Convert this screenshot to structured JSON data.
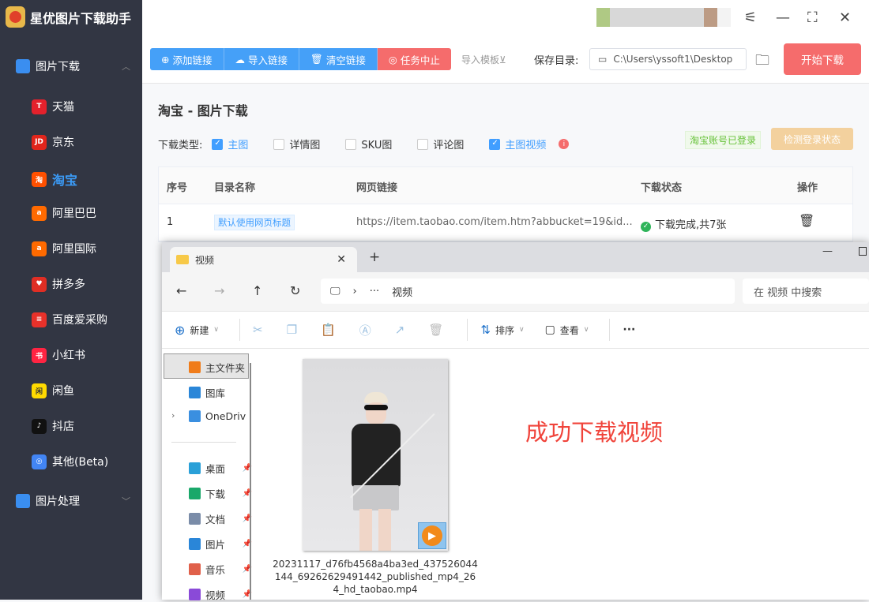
{
  "app": {
    "title": "星优图片下载助手"
  },
  "sidebar": {
    "groups": [
      {
        "label": "图片下载"
      },
      {
        "label": "图片处理"
      }
    ],
    "items": [
      {
        "label": "天猫",
        "icon": "T",
        "color": "#e4212c"
      },
      {
        "label": "京东",
        "icon": "JD",
        "color": "#e1251b"
      },
      {
        "label": "淘宝",
        "icon": "淘",
        "color": "#ff5000"
      },
      {
        "label": "阿里巴巴",
        "icon": "a",
        "color": "#ff6a00"
      },
      {
        "label": "阿里国际",
        "icon": "a",
        "color": "#ff6a00"
      },
      {
        "label": "拼多多",
        "icon": "♥",
        "color": "#e02e24"
      },
      {
        "label": "百度爱采购",
        "icon": "≡",
        "color": "#e8312a"
      },
      {
        "label": "小红书",
        "icon": "书",
        "color": "#ff2442"
      },
      {
        "label": "闲鱼",
        "icon": "闲",
        "color": "#ffda00"
      },
      {
        "label": "抖店",
        "icon": "♪",
        "color": "#111111"
      },
      {
        "label": "其他(Beta)",
        "icon": "◎",
        "color": "#4285f4"
      }
    ]
  },
  "toolbar": {
    "add": "添加链接",
    "import": "导入链接",
    "clear": "清空链接",
    "stop": "任务中止",
    "template": "导入模板⊻",
    "save_label": "保存目录:",
    "save_path": "C:\\Users\\yssoft1\\Desktop",
    "start": "开始下载"
  },
  "main": {
    "title": "淘宝 - 图片下载",
    "type_label": "下载类型:",
    "types": [
      {
        "label": "主图",
        "checked": true
      },
      {
        "label": "详情图",
        "checked": false
      },
      {
        "label": "SKU图",
        "checked": false
      },
      {
        "label": "评论图",
        "checked": false
      },
      {
        "label": "主图视频",
        "checked": true
      }
    ],
    "logged": "淘宝账号已登录",
    "check_login": "检测登录状态",
    "columns": [
      "序号",
      "目录名称",
      "网页链接",
      "下载状态",
      "操作"
    ],
    "rows": [
      {
        "no": "1",
        "dir": "默认使用网页标题",
        "url": "https://item.taobao.com/item.htm?abbucket=19&id...",
        "status": "下载完成,共7张"
      }
    ]
  },
  "explorer": {
    "tab": "视频",
    "address": "视频",
    "search_placeholder": "在 视频 中搜索",
    "new": "新建",
    "sort": "排序",
    "view": "查看",
    "more": "···",
    "nav": [
      {
        "label": "主文件夹"
      },
      {
        "label": "图库"
      },
      {
        "label": "OneDriv"
      },
      {
        "label": "桌面"
      },
      {
        "label": "下载"
      },
      {
        "label": "文档"
      },
      {
        "label": "图片"
      },
      {
        "label": "音乐"
      },
      {
        "label": "视频"
      }
    ],
    "file": "20231117_d76fb4568a4ba3ed_437526044144_69262629491442_published_mp4_264_hd_taobao.mp4"
  },
  "annotation": "成功下载视频"
}
